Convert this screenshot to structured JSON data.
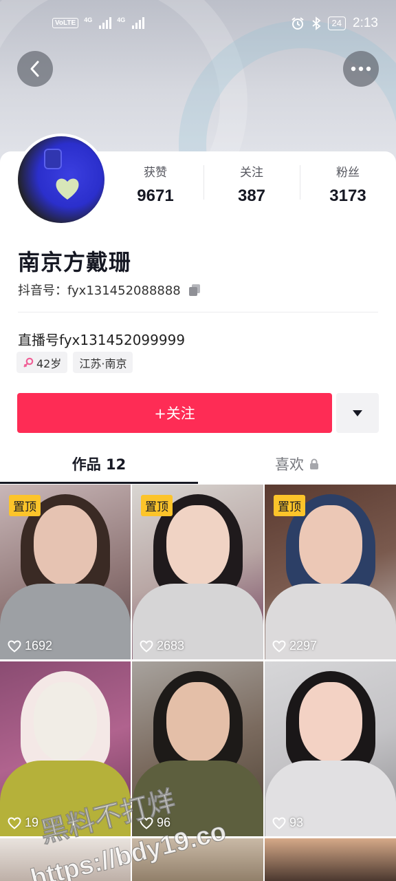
{
  "status_bar": {
    "volte": "VoLTE",
    "network1": "4G",
    "network2": "4G",
    "battery": "24",
    "time": "2:13"
  },
  "header": {
    "back_icon": "chevron-left-icon",
    "more_icon": "ellipsis-icon"
  },
  "profile": {
    "name": "南京方戴珊",
    "account_label": "抖音号：",
    "account_id": "fyx131452088888",
    "live_id": "直播号fyx131452099999",
    "stats": [
      {
        "label": "获赞",
        "value": "9671"
      },
      {
        "label": "关注",
        "value": "387"
      },
      {
        "label": "粉丝",
        "value": "3173"
      }
    ],
    "tags": {
      "age": "42岁",
      "location": "江苏·南京"
    }
  },
  "actions": {
    "follow_label": "+关注",
    "accent_color": "#fe2c55"
  },
  "tabs": {
    "works": "作品 12",
    "likes": "喜欢"
  },
  "videos": [
    {
      "pinned": "置顶",
      "likes": "1692"
    },
    {
      "pinned": "置顶",
      "likes": "2683"
    },
    {
      "pinned": "置顶",
      "likes": "2297"
    },
    {
      "pinned": "",
      "likes": "19"
    },
    {
      "pinned": "",
      "likes": "96"
    },
    {
      "pinned": "",
      "likes": "93"
    }
  ],
  "watermark": {
    "line1": "黑料不打烊",
    "line2": "https://bdy19.co"
  }
}
